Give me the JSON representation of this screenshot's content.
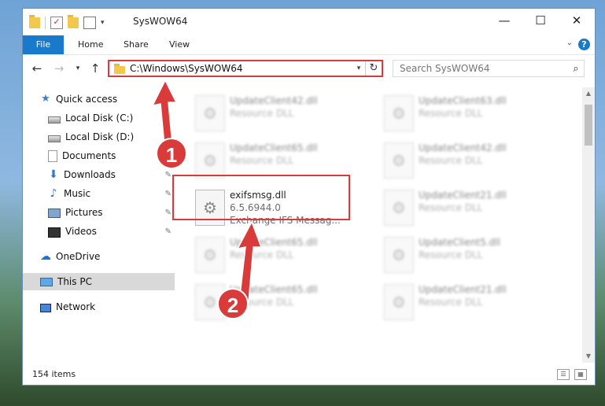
{
  "window": {
    "title": "SysWOW64",
    "controls": {
      "minimize": "—",
      "maximize": "☐",
      "close": "✕"
    }
  },
  "ribbon": {
    "tabs": [
      "File",
      "Home",
      "Share",
      "View"
    ]
  },
  "navbar": {
    "address": "C:\\Windows\\SysWOW64",
    "search_placeholder": "Search SysWOW64"
  },
  "sidebar": {
    "items": [
      {
        "label": "Quick access",
        "icon": "star-icon"
      },
      {
        "label": "Local Disk (C:)",
        "icon": "drive-icon",
        "pinned": true
      },
      {
        "label": "Local Disk (D:)",
        "icon": "drive-icon",
        "pinned": true
      },
      {
        "label": "Documents",
        "icon": "documents-icon",
        "pinned": true
      },
      {
        "label": "Downloads",
        "icon": "downloads-icon",
        "pinned": true
      },
      {
        "label": "Music",
        "icon": "music-icon",
        "pinned": true
      },
      {
        "label": "Pictures",
        "icon": "pictures-icon",
        "pinned": true
      },
      {
        "label": "Videos",
        "icon": "videos-icon",
        "pinned": true
      },
      {
        "label": "OneDrive",
        "icon": "onedrive-icon"
      },
      {
        "label": "This PC",
        "icon": "computer-icon",
        "selected": true
      },
      {
        "label": "Network",
        "icon": "network-icon"
      }
    ]
  },
  "files": [
    {
      "name": "UpdateClient42.dll",
      "type": "Resource DLL"
    },
    {
      "name": "UpdateClient63.dll",
      "type": "Resource DLL"
    },
    {
      "name": "UpdateClient65.dll",
      "type": "Resource DLL"
    },
    {
      "name": "UpdateClient42.dll",
      "type": "Resource DLL"
    },
    {
      "name": "exifsmsg.dll",
      "version": "6.5.6944.0",
      "description": "Exchange IFS Messag..."
    },
    {
      "name": "UpdateClient21.dll",
      "type": "Resource DLL"
    },
    {
      "name": "UpdateClient65.dll",
      "type": "Resource DLL"
    },
    {
      "name": "UpdateClient5.dll",
      "type": "Resource DLL"
    },
    {
      "name": "UpdateClient65.dll",
      "type": "Resource DLL"
    },
    {
      "name": "UpdateClient21.dll",
      "type": "Resource DLL"
    }
  ],
  "status": {
    "item_count": "154 items"
  },
  "annotations": {
    "step1": "1",
    "step2": "2",
    "color": "#d93a3a"
  }
}
